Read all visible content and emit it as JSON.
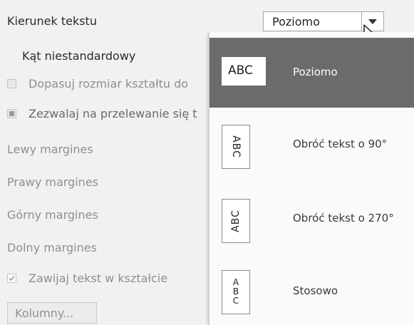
{
  "text_direction": {
    "label": "Kierunek tekstu",
    "selected": "Poziomo"
  },
  "custom_angle": {
    "label": "Kąt niestandardowy"
  },
  "fit_shape": {
    "label": "Dopasuj rozmiar kształtu do"
  },
  "allow_overflow": {
    "label": "Zezwalaj na przelewanie się t"
  },
  "margins": {
    "left": "Lewy margines",
    "right": "Prawy margines",
    "top": "Górny margines",
    "bottom": "Dolny margines"
  },
  "wrap_text": {
    "label": "Zawijaj tekst w kształcie"
  },
  "columns_button": {
    "label": "Kolumny..."
  },
  "dropdown": {
    "options": [
      {
        "label": "Poziomo",
        "sample": "ABC",
        "selected": true
      },
      {
        "label": "Obróć tekst o 90°",
        "sample": "ABC"
      },
      {
        "label": "Obróć tekst o 270°",
        "sample": "ABC"
      },
      {
        "label": "Stosowo",
        "sample_lines": [
          "A",
          "B",
          "C"
        ]
      }
    ]
  },
  "colors": {
    "background": "#f1f1f1",
    "selected_option": "#6b6b6b",
    "disabled_text": "#8f8f8f"
  },
  "icons": {
    "dropdown_arrow": "chevron-down-icon",
    "cursor": "mouse-pointer-icon"
  }
}
